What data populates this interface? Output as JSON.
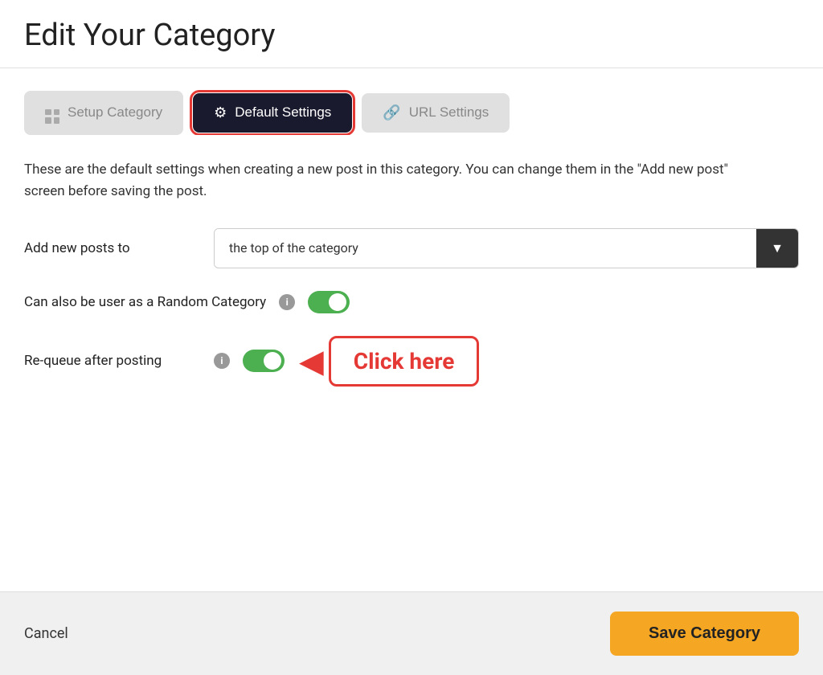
{
  "page": {
    "title": "Edit Your Category"
  },
  "tabs": {
    "setup": {
      "label": "Setup Category",
      "state": "inactive"
    },
    "default": {
      "label": "Default Settings",
      "state": "active"
    },
    "url": {
      "label": "URL Settings",
      "state": "inactive"
    }
  },
  "content": {
    "description": "These are the default settings when creating a new post in this category. You can change them in the \"Add new post\" screen before saving the post.",
    "add_new_posts": {
      "label": "Add new posts to",
      "dropdown_value": "the top of the category"
    },
    "random_category": {
      "label": "Can also be user as a Random Category",
      "enabled": true
    },
    "requeue": {
      "label": "Re-queue after posting",
      "enabled": true
    },
    "annotation": {
      "text": "Click here"
    }
  },
  "footer": {
    "cancel_label": "Cancel",
    "save_label": "Save Category"
  }
}
